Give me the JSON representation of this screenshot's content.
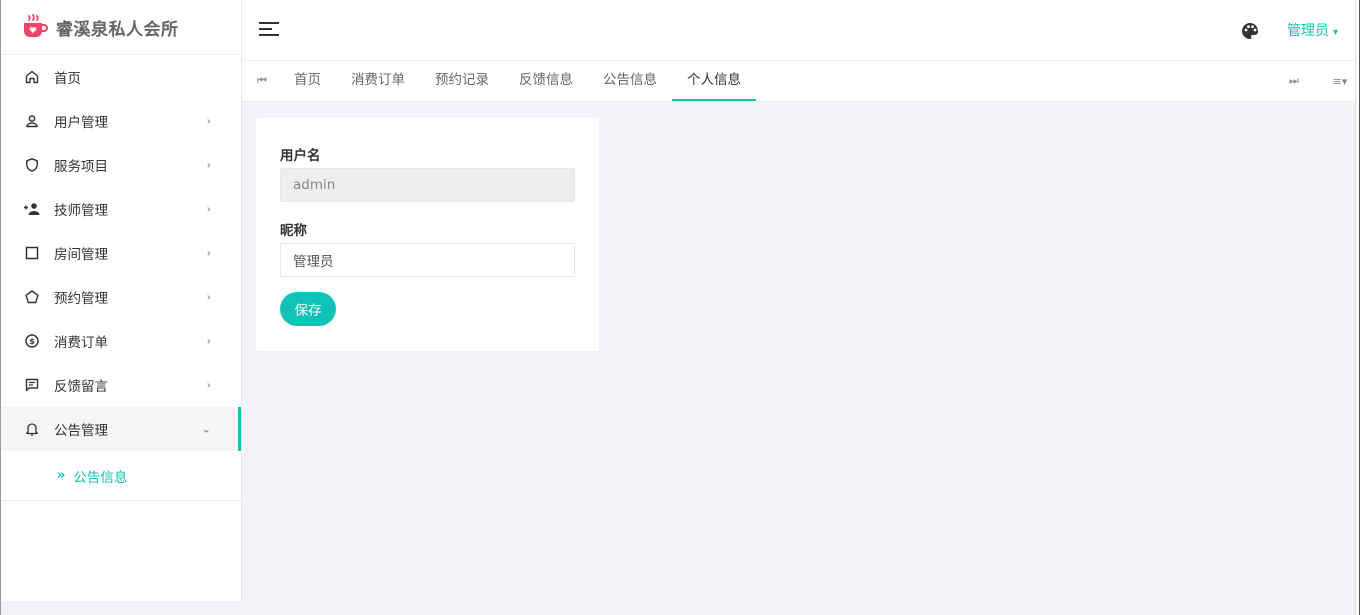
{
  "app": {
    "title": "睿溪泉私人会所",
    "accent_color": "#11c3b6",
    "logo_color": "#f0446b"
  },
  "sidebar": {
    "items": [
      {
        "label": "首页",
        "icon": "home-icon",
        "has_children": false
      },
      {
        "label": "用户管理",
        "icon": "user-icon",
        "has_children": true
      },
      {
        "label": "服务项目",
        "icon": "shield-icon",
        "has_children": true
      },
      {
        "label": "技师管理",
        "icon": "add-person-icon",
        "has_children": true
      },
      {
        "label": "房间管理",
        "icon": "square-icon",
        "has_children": true
      },
      {
        "label": "预约管理",
        "icon": "pentagon-icon",
        "has_children": true
      },
      {
        "label": "消费订单",
        "icon": "dollar-circle-icon",
        "has_children": true
      },
      {
        "label": "反馈留言",
        "icon": "message-icon",
        "has_children": true
      },
      {
        "label": "公告管理",
        "icon": "bell-icon",
        "has_children": true,
        "expanded": true
      }
    ],
    "sub_item": {
      "label": "公告信息",
      "marker": "»"
    }
  },
  "header": {
    "menu_icon": "hamburger-icon",
    "theme_icon": "palette-icon",
    "user_label": "管理员",
    "user_caret": "▾"
  },
  "tabbar": {
    "prev_icon": "⏮",
    "next_icon": "⏭",
    "more_icon": "≡▾",
    "tabs": [
      {
        "label": "首页",
        "active": false
      },
      {
        "label": "消费订单",
        "active": false
      },
      {
        "label": "预约记录",
        "active": false
      },
      {
        "label": "反馈信息",
        "active": false
      },
      {
        "label": "公告信息",
        "active": false
      },
      {
        "label": "个人信息",
        "active": true
      }
    ]
  },
  "form": {
    "username_label": "用户名",
    "username_value": "admin",
    "nickname_label": "昵称",
    "nickname_value": "管理员",
    "save_label": "保存"
  }
}
